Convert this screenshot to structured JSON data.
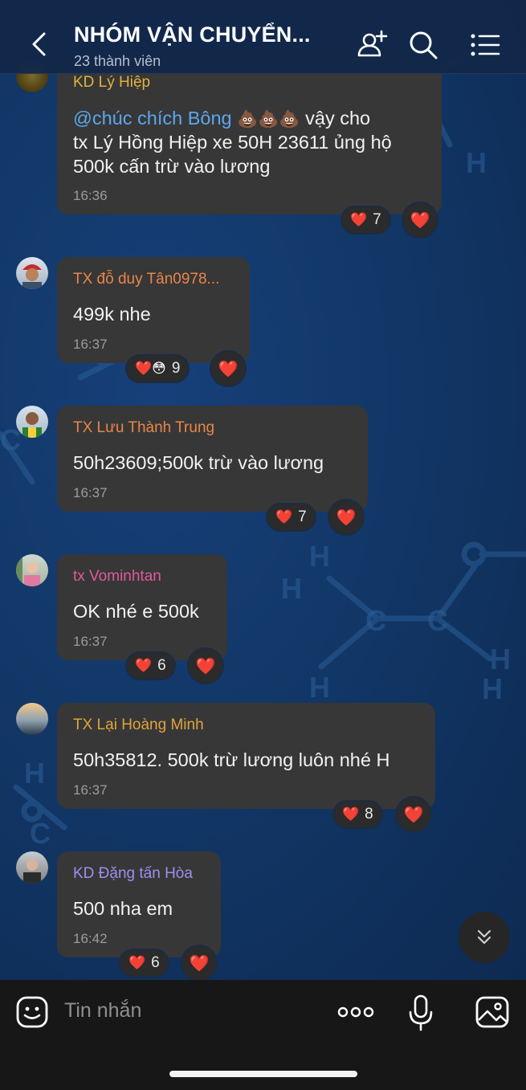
{
  "header": {
    "title": "NHÓM VẬN CHUYỂN...",
    "subtitle": "23 thành viên",
    "icons": [
      "back-arrow-icon",
      "add-member-icon",
      "search-icon",
      "menu-list-icon"
    ]
  },
  "messages": [
    {
      "sender": "KD Lý Hiệp",
      "sender_color": "#e0b341",
      "mention": "@chúc chích Bông",
      "emoji": "💩💩💩",
      "lines": [
        "vậy cho",
        "tx Lý Hồng Hiệp xe 50H 23611 ủng hộ",
        "500k cấn trừ vào lương"
      ],
      "time": "16:36",
      "reaction_emojis": "❤️",
      "reaction_count": "7"
    },
    {
      "sender": "TX đỗ duy Tân0978...",
      "sender_color": "#e8864a",
      "lines": [
        "499k nhe"
      ],
      "time": "16:37",
      "reaction_emojis": "❤️😳",
      "reaction_count": "9"
    },
    {
      "sender": "TX Lưu Thành Trung",
      "sender_color": "#e8864a",
      "lines": [
        "50h23609;500k trừ vào lương"
      ],
      "time": "16:37",
      "reaction_emojis": "❤️",
      "reaction_count": "7"
    },
    {
      "sender": "tx Vominhtan",
      "sender_color": "#e0599a",
      "lines": [
        "OK nhé e 500k"
      ],
      "time": "16:37",
      "reaction_emojis": "❤️",
      "reaction_count": "6"
    },
    {
      "sender": "TX Lại Hoàng Minh",
      "sender_color": "#e0a43c",
      "lines": [
        "50h35812. 500k trừ lương luôn nhé H"
      ],
      "time": "16:37",
      "reaction_emojis": "❤️",
      "reaction_count": "8"
    },
    {
      "sender": "KD Đặng tấn Hòa",
      "sender_color": "#9d8ff0",
      "lines": [
        "500 nha em"
      ],
      "time": "16:42",
      "reaction_emojis": "❤️",
      "reaction_count": "6"
    }
  ],
  "quick_reaction": "❤️",
  "input": {
    "placeholder": "Tin nhắn",
    "icons": [
      "emoji-sticker-icon",
      "more-options-icon",
      "microphone-icon",
      "image-icon"
    ]
  },
  "colors": {
    "header_bg": "#12284a",
    "bubble_bg": "#373737",
    "input_bar_bg": "#171717",
    "mention": "#5aa7ee"
  }
}
